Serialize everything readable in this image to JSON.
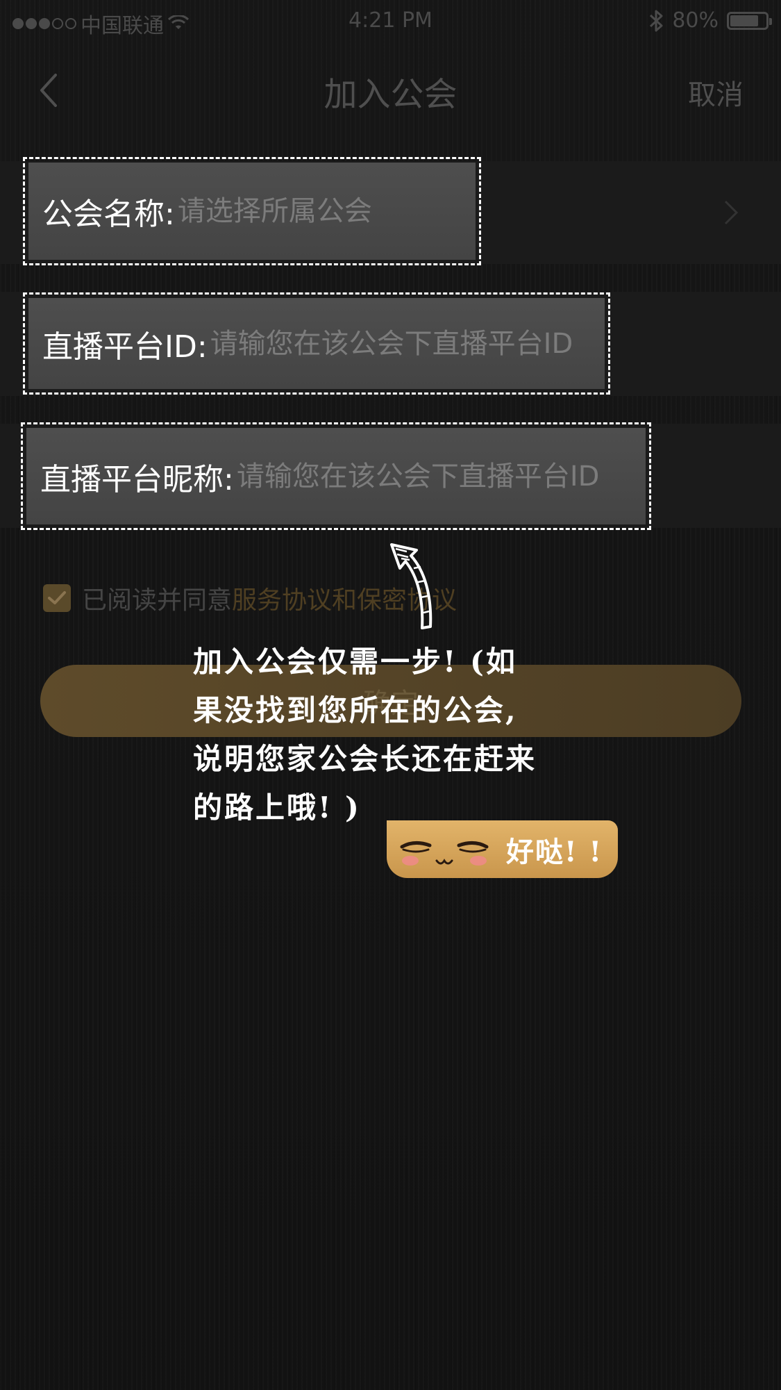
{
  "status_bar": {
    "carrier": "中国联通",
    "time": "4:21 PM",
    "battery": "80%",
    "battery_level": 0.8
  },
  "nav": {
    "title": "加入公会",
    "cancel_label": "取消"
  },
  "form": {
    "guild_name": {
      "label": "公会名称:",
      "placeholder": "请选择所属公会"
    },
    "platform_id": {
      "label": "直播平台ID:",
      "placeholder": "请输您在该公会下直播平台ID"
    },
    "platform_nickname": {
      "label": "直播平台昵称:",
      "placeholder": "请输您在该公会下直播平台ID"
    }
  },
  "agreement": {
    "prefix": "已阅读并同意",
    "link": "服务协议和保密协议",
    "checked": true
  },
  "confirm_label": "确定",
  "tip": {
    "lines": [
      "加入公会仅需一步! (如",
      "果没找到您所在的公会,",
      "说明您家公会长还在赶来",
      "的路上哦! )"
    ],
    "ok_label": "好哒! !"
  },
  "colors": {
    "background": "#141414",
    "accent_gold": "#d6a65c",
    "highlight_border": "#ffffff"
  }
}
